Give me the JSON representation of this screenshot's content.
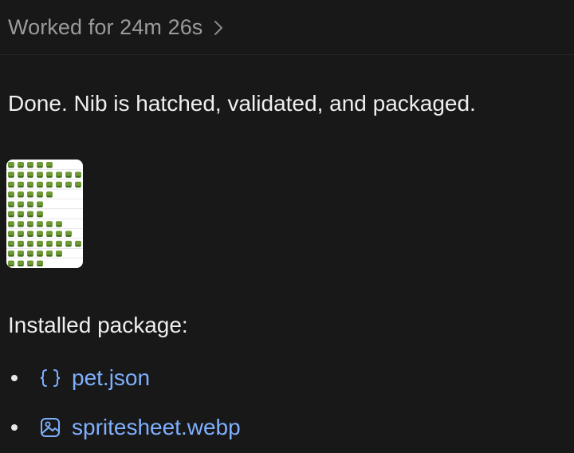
{
  "header": {
    "label": "Worked for 24m 26s",
    "chevron_icon": "chevron-right-icon"
  },
  "message": {
    "text": "Done. Nib is hatched, validated, and packaged."
  },
  "spritesheet_preview": {
    "kind": "image-thumbnail",
    "colors": {
      "sprite": "#6e9a35",
      "sprite_dark": "#3f6a22",
      "background": "#ffffff"
    }
  },
  "installed": {
    "title": "Installed package:",
    "files": [
      {
        "icon": "json-braces-icon",
        "name": "pet.json"
      },
      {
        "icon": "image-file-icon",
        "name": "spritesheet.webp"
      }
    ]
  },
  "colors": {
    "background": "#181818",
    "muted_text": "#9b9b9b",
    "text": "#efefef",
    "link": "#7fb0ff"
  }
}
